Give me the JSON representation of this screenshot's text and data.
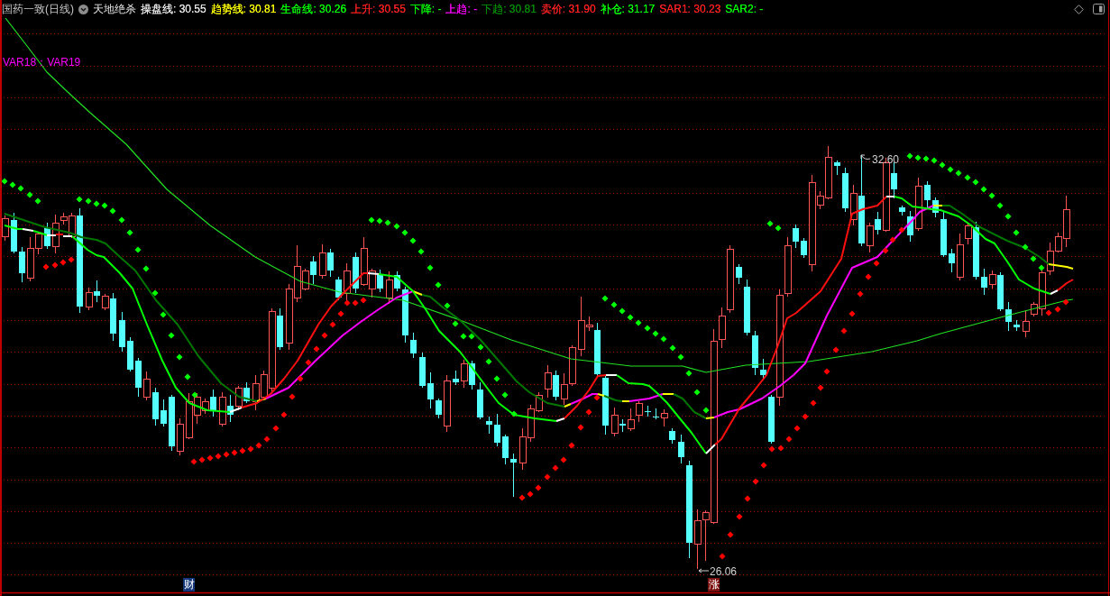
{
  "header": {
    "title": "国药一致(日线)",
    "indicator": "天地绝杀",
    "readings": [
      {
        "text": "操盘线: 30.55",
        "color": "#e6e6e6"
      },
      {
        "text": "趋势线: 30.81",
        "color": "#ffff00"
      },
      {
        "text": "生命线: 30.26",
        "color": "#00ff00"
      },
      {
        "text": "上升: 30.55",
        "color": "#ff2020"
      },
      {
        "text": "下降: -",
        "color": "#00ff00"
      },
      {
        "text": "上趋: -",
        "color": "#ff00ff"
      },
      {
        "text": "下趋: 30.81",
        "color": "#008c00"
      },
      {
        "text": "卖价: 31.90",
        "color": "#ff2020"
      },
      {
        "text": "补仓: 31.17",
        "color": "#00ff00"
      },
      {
        "text": "SAR1: 30.23",
        "color": "#ff2020"
      },
      {
        "text": "SAR2: -",
        "color": "#00ff00"
      }
    ]
  },
  "chart": {
    "legend": "VAR18：VAR19",
    "high_label": "32.60",
    "low_label": "26.06",
    "markers": [
      {
        "text": "财",
        "color": "#13377a"
      },
      {
        "text": "涨",
        "color": "#7d1010"
      }
    ]
  }
}
